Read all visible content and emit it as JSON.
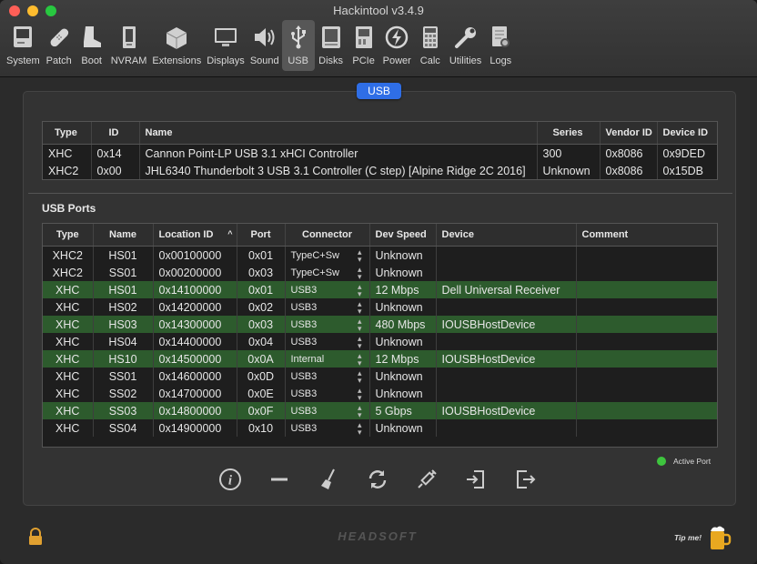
{
  "window": {
    "title": "Hackintool v3.4.9"
  },
  "toolbar": {
    "items": [
      {
        "label": "System",
        "icon": "system-icon"
      },
      {
        "label": "Patch",
        "icon": "patch-icon"
      },
      {
        "label": "Boot",
        "icon": "boot-icon"
      },
      {
        "label": "NVRAM",
        "icon": "nvram-icon"
      },
      {
        "label": "Extensions",
        "icon": "extensions-icon"
      },
      {
        "label": "Displays",
        "icon": "displays-icon"
      },
      {
        "label": "Sound",
        "icon": "sound-icon"
      },
      {
        "label": "USB",
        "icon": "usb-icon",
        "active": true
      },
      {
        "label": "Disks",
        "icon": "disks-icon"
      },
      {
        "label": "PCIe",
        "icon": "pcie-icon"
      },
      {
        "label": "Power",
        "icon": "power-icon"
      },
      {
        "label": "Calc",
        "icon": "calc-icon"
      },
      {
        "label": "Utilities",
        "icon": "utilities-icon"
      },
      {
        "label": "Logs",
        "icon": "logs-icon"
      }
    ]
  },
  "segment": {
    "label": "USB"
  },
  "controllers": {
    "headers": {
      "type": "Type",
      "id": "ID",
      "name": "Name",
      "series": "Series",
      "vendor": "Vendor ID",
      "device": "Device ID"
    },
    "rows": [
      {
        "type": "XHC",
        "id": "0x14",
        "name": "Cannon Point-LP USB 3.1 xHCI Controller",
        "series": "300",
        "vendor": "0x8086",
        "device": "0x9DED"
      },
      {
        "type": "XHC2",
        "id": "0x00",
        "name": "JHL6340 Thunderbolt 3 USB 3.1 Controller (C step) [Alpine Ridge 2C 2016]",
        "series": "Unknown",
        "vendor": "0x8086",
        "device": "0x15DB"
      }
    ]
  },
  "ports": {
    "section_title": "USB Ports",
    "headers": {
      "type": "Type",
      "name": "Name",
      "location": "Location ID",
      "port": "Port",
      "connector": "Connector",
      "speed": "Dev Speed",
      "device": "Device",
      "comment": "Comment"
    },
    "rows": [
      {
        "type": "XHC2",
        "name": "HS01",
        "location": "0x00100000",
        "port": "0x01",
        "connector": "TypeC+Sw",
        "speed": "Unknown",
        "device": "",
        "comment": "",
        "active": false
      },
      {
        "type": "XHC2",
        "name": "SS01",
        "location": "0x00200000",
        "port": "0x03",
        "connector": "TypeC+Sw",
        "speed": "Unknown",
        "device": "",
        "comment": "",
        "active": false
      },
      {
        "type": "XHC",
        "name": "HS01",
        "location": "0x14100000",
        "port": "0x01",
        "connector": "USB3",
        "speed": "12 Mbps",
        "device": "Dell Universal Receiver",
        "comment": "",
        "active": true
      },
      {
        "type": "XHC",
        "name": "HS02",
        "location": "0x14200000",
        "port": "0x02",
        "connector": "USB3",
        "speed": "Unknown",
        "device": "",
        "comment": "",
        "active": false
      },
      {
        "type": "XHC",
        "name": "HS03",
        "location": "0x14300000",
        "port": "0x03",
        "connector": "USB3",
        "speed": "480 Mbps",
        "device": "IOUSBHostDevice",
        "comment": "",
        "active": true
      },
      {
        "type": "XHC",
        "name": "HS04",
        "location": "0x14400000",
        "port": "0x04",
        "connector": "USB3",
        "speed": "Unknown",
        "device": "",
        "comment": "",
        "active": false
      },
      {
        "type": "XHC",
        "name": "HS10",
        "location": "0x14500000",
        "port": "0x0A",
        "connector": "Internal",
        "speed": "12 Mbps",
        "device": "IOUSBHostDevice",
        "comment": "",
        "active": true
      },
      {
        "type": "XHC",
        "name": "SS01",
        "location": "0x14600000",
        "port": "0x0D",
        "connector": "USB3",
        "speed": "Unknown",
        "device": "",
        "comment": "",
        "active": false
      },
      {
        "type": "XHC",
        "name": "SS02",
        "location": "0x14700000",
        "port": "0x0E",
        "connector": "USB3",
        "speed": "Unknown",
        "device": "",
        "comment": "",
        "active": false
      },
      {
        "type": "XHC",
        "name": "SS03",
        "location": "0x14800000",
        "port": "0x0F",
        "connector": "USB3",
        "speed": "5 Gbps",
        "device": "IOUSBHostDevice",
        "comment": "",
        "active": true
      },
      {
        "type": "XHC",
        "name": "SS04",
        "location": "0x14900000",
        "port": "0x10",
        "connector": "USB3",
        "speed": "Unknown",
        "device": "",
        "comment": "",
        "active": false
      }
    ]
  },
  "legend": {
    "active_port": "Active Port",
    "color": "#3ec43e"
  },
  "actions": [
    {
      "icon": "info-icon"
    },
    {
      "icon": "minus-icon"
    },
    {
      "icon": "broom-icon"
    },
    {
      "icon": "refresh-icon"
    },
    {
      "icon": "syringe-icon"
    },
    {
      "icon": "import-icon"
    },
    {
      "icon": "export-icon"
    }
  ],
  "footer": {
    "brand": "HEADSOFT",
    "tip": "Tip me!"
  },
  "colors": {
    "accent": "#2f6ee6",
    "active_row": "#2d5b2d"
  }
}
